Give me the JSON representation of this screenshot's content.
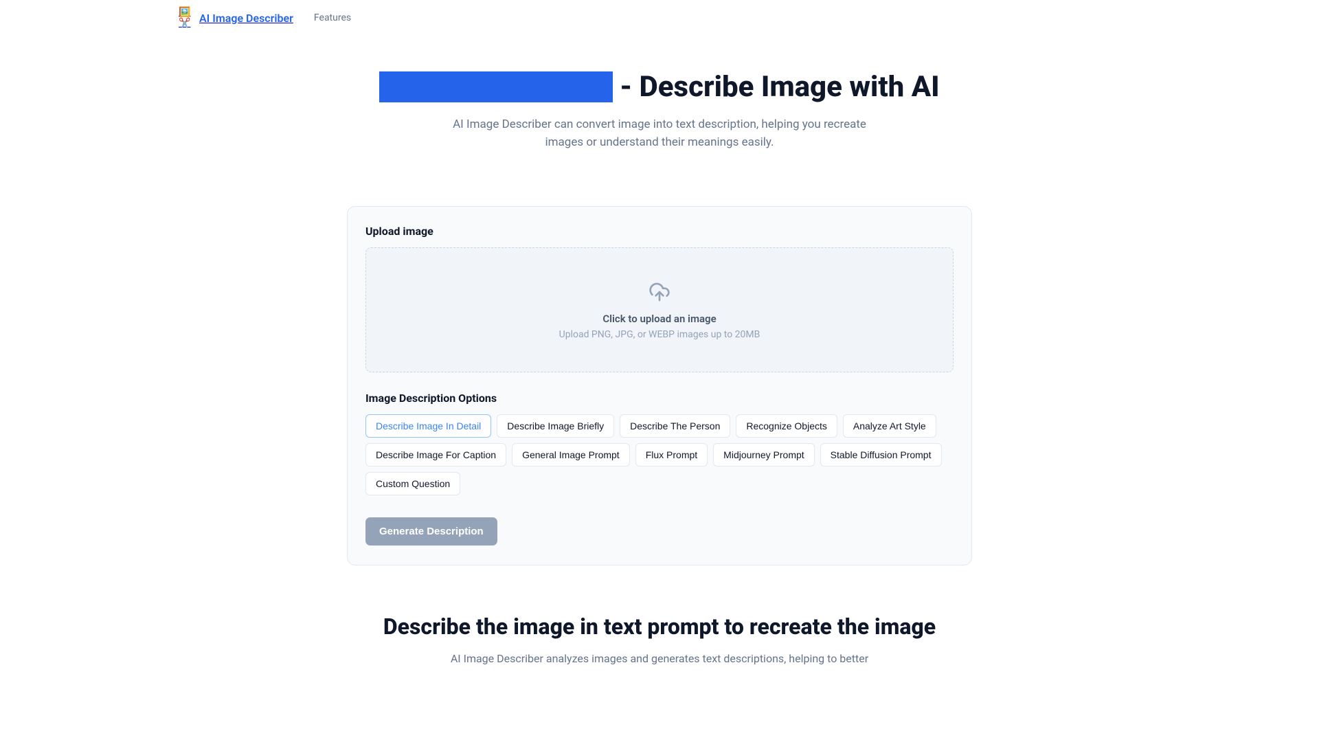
{
  "header": {
    "brand": "AI Image Describer",
    "nav_features": "Features"
  },
  "hero": {
    "title_suffix": "- Describe Image with AI",
    "subtitle": "AI Image Describer can convert image into text description, helping you recreate images or understand their meanings easily."
  },
  "upload": {
    "section_label": "Upload image",
    "primary": "Click to upload an image",
    "secondary": "Upload PNG, JPG, or WEBP images up to 20MB"
  },
  "options": {
    "section_label": "Image Description Options",
    "items": [
      "Describe Image In Detail",
      "Describe Image Briefly",
      "Describe The Person",
      "Recognize Objects",
      "Analyze Art Style",
      "Describe Image For Caption",
      "General Image Prompt",
      "Flux Prompt",
      "Midjourney Prompt",
      "Stable Diffusion Prompt",
      "Custom Question"
    ],
    "selected_index": 0
  },
  "generate_label": "Generate Description",
  "below": {
    "title": "Describe the image in text prompt to recreate the image",
    "text": "AI Image Describer analyzes images and generates text descriptions, helping to better"
  }
}
